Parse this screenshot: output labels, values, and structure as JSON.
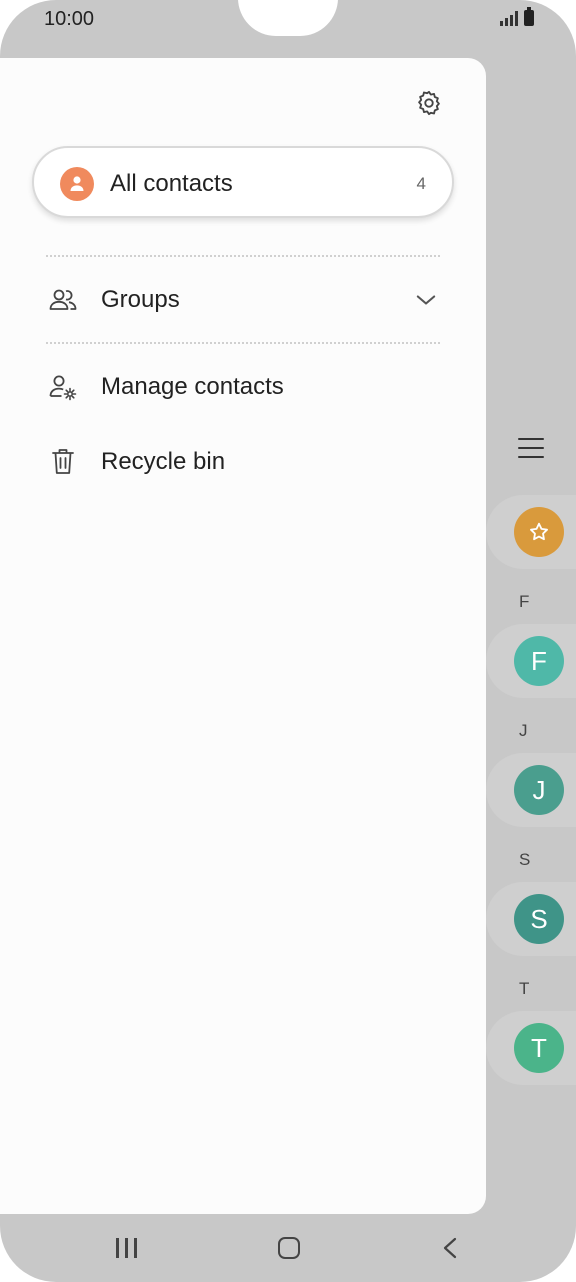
{
  "status_bar": {
    "time": "10:00"
  },
  "drawer": {
    "all_contacts": {
      "label": "All contacts",
      "count": "4"
    },
    "menu": [
      {
        "label": "Groups",
        "icon": "groups-icon"
      },
      {
        "label": "Manage contacts",
        "icon": "manage-contacts-icon"
      },
      {
        "label": "Recycle bin",
        "icon": "trash-icon"
      }
    ]
  },
  "contact_strip": {
    "sections": [
      {
        "letter": "F",
        "initial": "F"
      },
      {
        "letter": "J",
        "initial": "J"
      },
      {
        "letter": "S",
        "initial": "S"
      },
      {
        "letter": "T",
        "initial": "T"
      }
    ]
  },
  "colors": {
    "accent_orange": "#f08a5d",
    "favorites": "#d99a3c",
    "teal_f": "#4fb8a8",
    "teal_j": "#4a9e8e",
    "teal_s": "#3f9488",
    "green_t": "#4bb48a"
  }
}
